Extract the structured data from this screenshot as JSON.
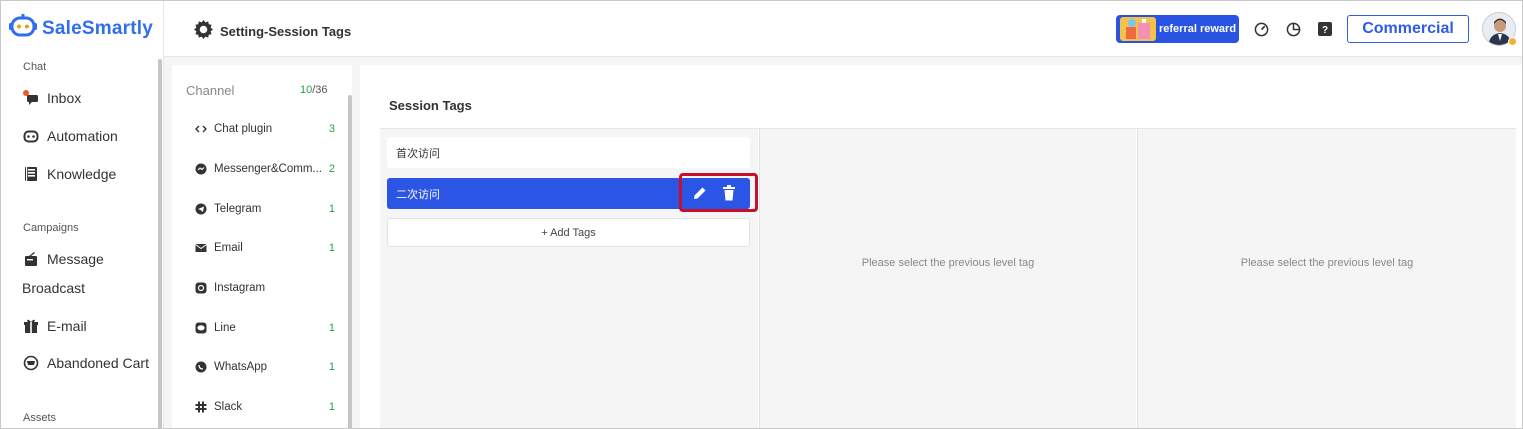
{
  "brand": {
    "name": "SaleSmartly",
    "color": "#2f6fed"
  },
  "sidebar": {
    "sections": [
      {
        "label": "Chat"
      },
      {
        "label": "Campaigns"
      },
      {
        "label": "Assets"
      }
    ],
    "items": [
      {
        "label": "Inbox",
        "icon": "inbox-icon"
      },
      {
        "label": "Automation",
        "icon": "robot-icon"
      },
      {
        "label": "Knowledge",
        "icon": "book-icon"
      },
      {
        "label": "Message",
        "label2": "Broadcast",
        "icon": "broadcast-icon"
      },
      {
        "label": "E-mail",
        "icon": "gift-icon"
      },
      {
        "label": "Abandoned Cart",
        "icon": "cart-icon"
      }
    ]
  },
  "header": {
    "title": "Setting-Session Tags",
    "referral_label": "referral reward",
    "plan_label": "Commercial"
  },
  "channels": {
    "title": "Channel",
    "used": "10",
    "total": "/36",
    "items": [
      {
        "name": "Chat plugin",
        "count": "3",
        "icon": "code-icon"
      },
      {
        "name": "Messenger&Comm...",
        "count": "2",
        "icon": "messenger-icon"
      },
      {
        "name": "Telegram",
        "count": "1",
        "icon": "telegram-icon"
      },
      {
        "name": "Email",
        "count": "1",
        "icon": "mail-icon"
      },
      {
        "name": "Instagram",
        "count": "",
        "icon": "instagram-icon"
      },
      {
        "name": "Line",
        "count": "1",
        "icon": "line-icon"
      },
      {
        "name": "WhatsApp",
        "count": "1",
        "icon": "whatsapp-icon"
      },
      {
        "name": "Slack",
        "count": "1",
        "icon": "slack-icon"
      }
    ]
  },
  "session_tags": {
    "title": "Session Tags",
    "tags": [
      {
        "label": "首次访问",
        "selected": false
      },
      {
        "label": "二次访问",
        "selected": true
      }
    ],
    "add_label": "+ Add Tags",
    "empty_level2": "Please select the previous level tag",
    "empty_level3": "Please select the previous level tag"
  },
  "colors": {
    "accent": "#2a55e5",
    "count_green": "#24a148",
    "highlight": "#c8102e"
  }
}
